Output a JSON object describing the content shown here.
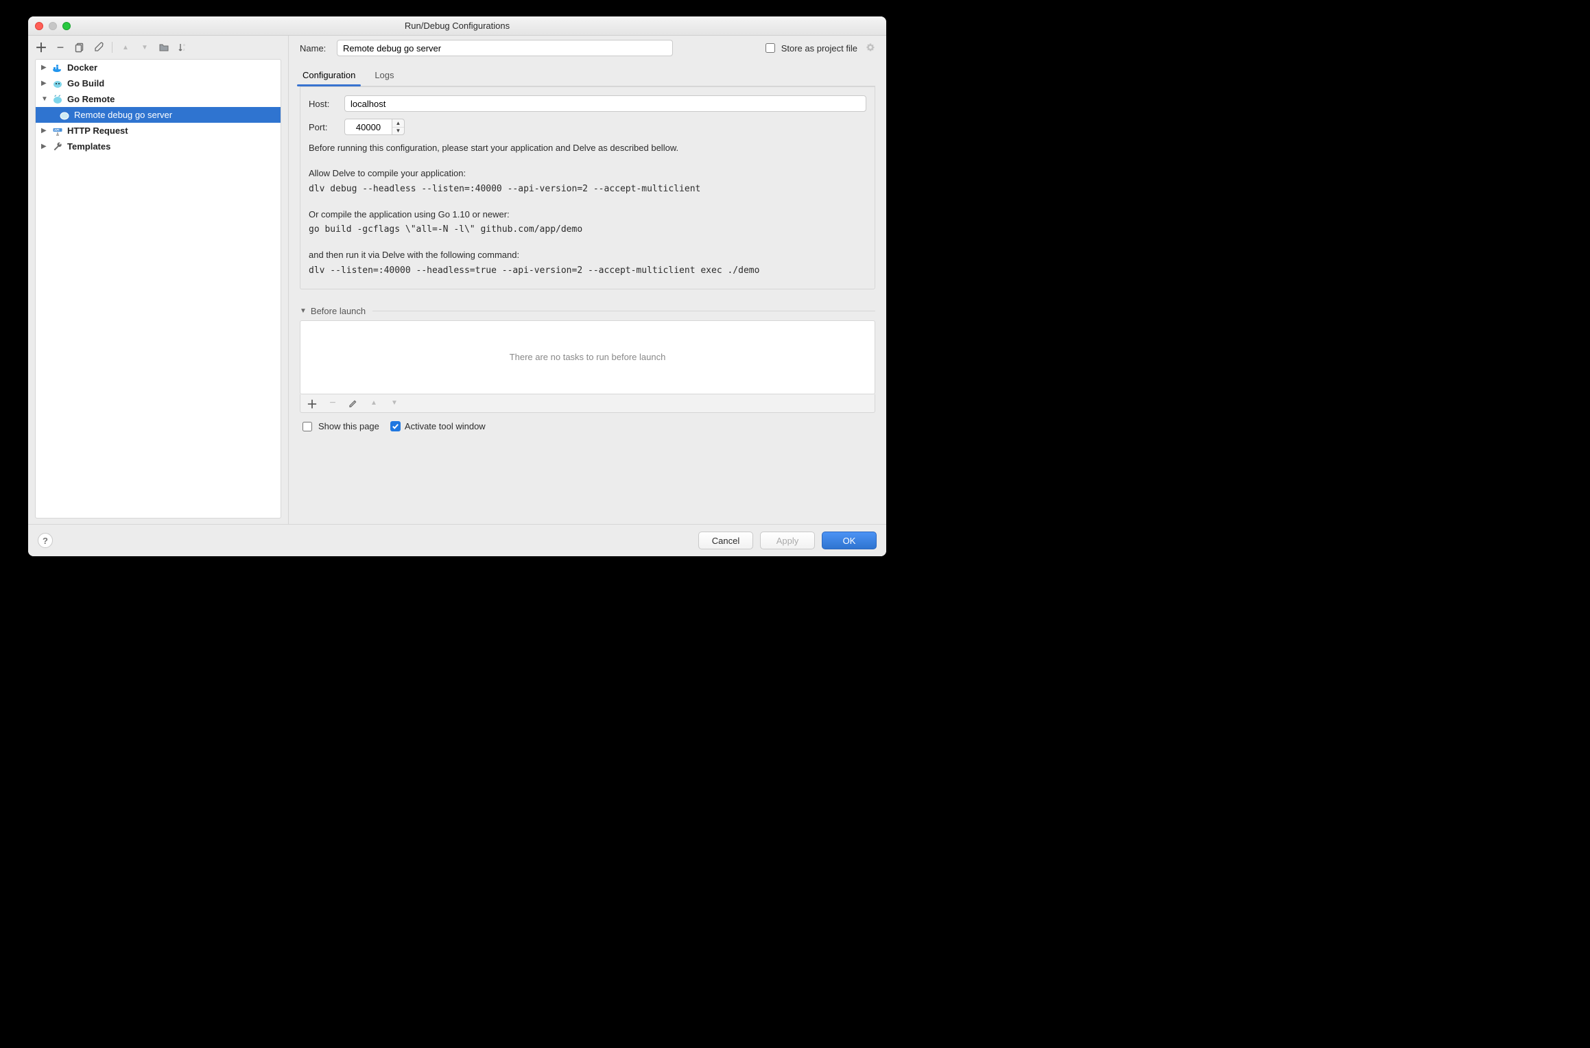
{
  "window": {
    "title": "Run/Debug Configurations"
  },
  "sidebar": {
    "toolbar": {
      "add": "+",
      "remove": "−",
      "copy": "⧉",
      "wrench": "wrench",
      "up": "▲",
      "down": "▼",
      "folder": "folder",
      "sort": "sort-az"
    },
    "tree": [
      {
        "expanded": false,
        "icon": "docker-icon",
        "label": "Docker"
      },
      {
        "expanded": false,
        "icon": "go-icon",
        "label": "Go Build"
      },
      {
        "expanded": true,
        "icon": "go-remote-icon",
        "label": "Go Remote",
        "children": [
          {
            "icon": "go-item-icon",
            "label": "Remote debug go server",
            "selected": true
          }
        ]
      },
      {
        "expanded": false,
        "icon": "http-icon",
        "label": "HTTP Request"
      },
      {
        "expanded": false,
        "icon": "wrench-icon",
        "label": "Templates"
      }
    ]
  },
  "form": {
    "name_label": "Name:",
    "name_value": "Remote debug go server",
    "store_as_project": "Store as project file",
    "tabs": {
      "configuration": "Configuration",
      "logs": "Logs",
      "active": "configuration"
    },
    "host_label": "Host:",
    "host_value": "localhost",
    "port_label": "Port:",
    "port_value": "40000",
    "help": {
      "line1": "Before running this configuration, please start your application and Delve as described bellow.",
      "line2": "Allow Delve to compile your application:",
      "cmd1": "dlv debug --headless --listen=:40000 --api-version=2 --accept-multiclient",
      "line3": "Or compile the application using Go 1.10 or newer:",
      "cmd2": "go build -gcflags \\\"all=-N -l\\\" github.com/app/demo",
      "line4": "and then run it via Delve with the following command:",
      "cmd3": "dlv --listen=:40000 --headless=true --api-version=2 --accept-multiclient exec ./demo"
    },
    "before_launch": {
      "title": "Before launch",
      "empty": "There are no tasks to run before launch",
      "show_this_page": "Show this page",
      "activate_tool_window": "Activate tool window",
      "activate_checked": true
    }
  },
  "footer": {
    "cancel": "Cancel",
    "apply": "Apply",
    "ok": "OK"
  }
}
